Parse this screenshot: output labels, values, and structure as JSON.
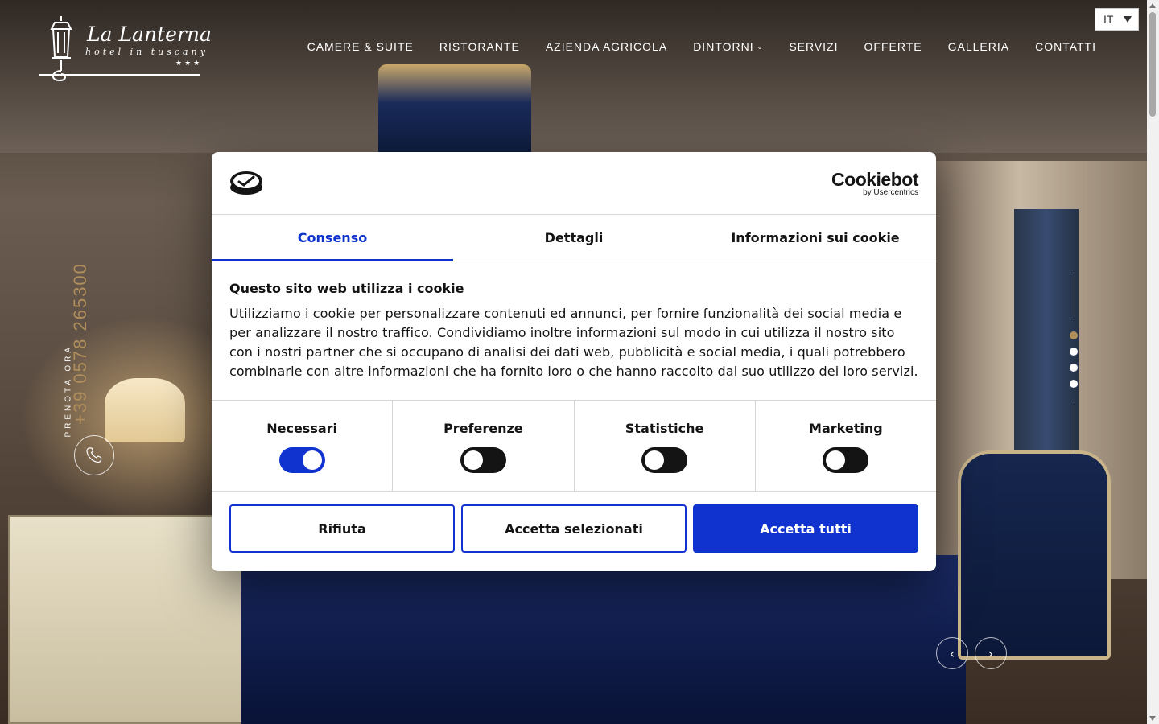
{
  "brand": {
    "name": "La Lanterna",
    "tagline": "hotel in tuscany",
    "stars": "★★★"
  },
  "nav": [
    {
      "label": "CAMERE & SUITE"
    },
    {
      "label": "RISTORANTE"
    },
    {
      "label": "AZIENDA AGRICOLA"
    },
    {
      "label": "DINTORNI",
      "has_dropdown": true
    },
    {
      "label": "SERVIZI"
    },
    {
      "label": "OFFERTE"
    },
    {
      "label": "GALLERIA"
    },
    {
      "label": "CONTATTI"
    }
  ],
  "language": {
    "selected": "IT"
  },
  "booking": {
    "label": "PRENOTA ORA",
    "phone": "+39 0578 265300"
  },
  "slider": {
    "slide_count": 4,
    "active_index": 0,
    "prev_icon": "chevron-left-icon",
    "next_icon": "chevron-right-icon"
  },
  "cookie": {
    "provider": "Cookiebot",
    "provider_sub": "by Usercentrics",
    "tabs": [
      "Consenso",
      "Dettagli",
      "Informazioni sui cookie"
    ],
    "active_tab": 0,
    "title": "Questo sito web utilizza i cookie",
    "text": "Utilizziamo i cookie per personalizzare contenuti ed annunci, per fornire funzionalità dei social media e per analizzare il nostro traffico. Condividiamo inoltre informazioni sul modo in cui utilizza il nostro sito con i nostri partner che si occupano di analisi dei dati web, pubblicità e social media, i quali potrebbero combinarle con altre informazioni che ha fornito loro o che hanno raccolto dal suo utilizzo dei loro servizi.",
    "categories": [
      {
        "label": "Necessari",
        "on": true
      },
      {
        "label": "Preferenze",
        "on": false
      },
      {
        "label": "Statistiche",
        "on": false
      },
      {
        "label": "Marketing",
        "on": false
      }
    ],
    "buttons": {
      "reject": "Rifiuta",
      "accept_selected": "Accetta selezionati",
      "accept_all": "Accetta tutti"
    }
  },
  "colors": {
    "accent": "#1032cf",
    "gold": "#b08f5c"
  }
}
